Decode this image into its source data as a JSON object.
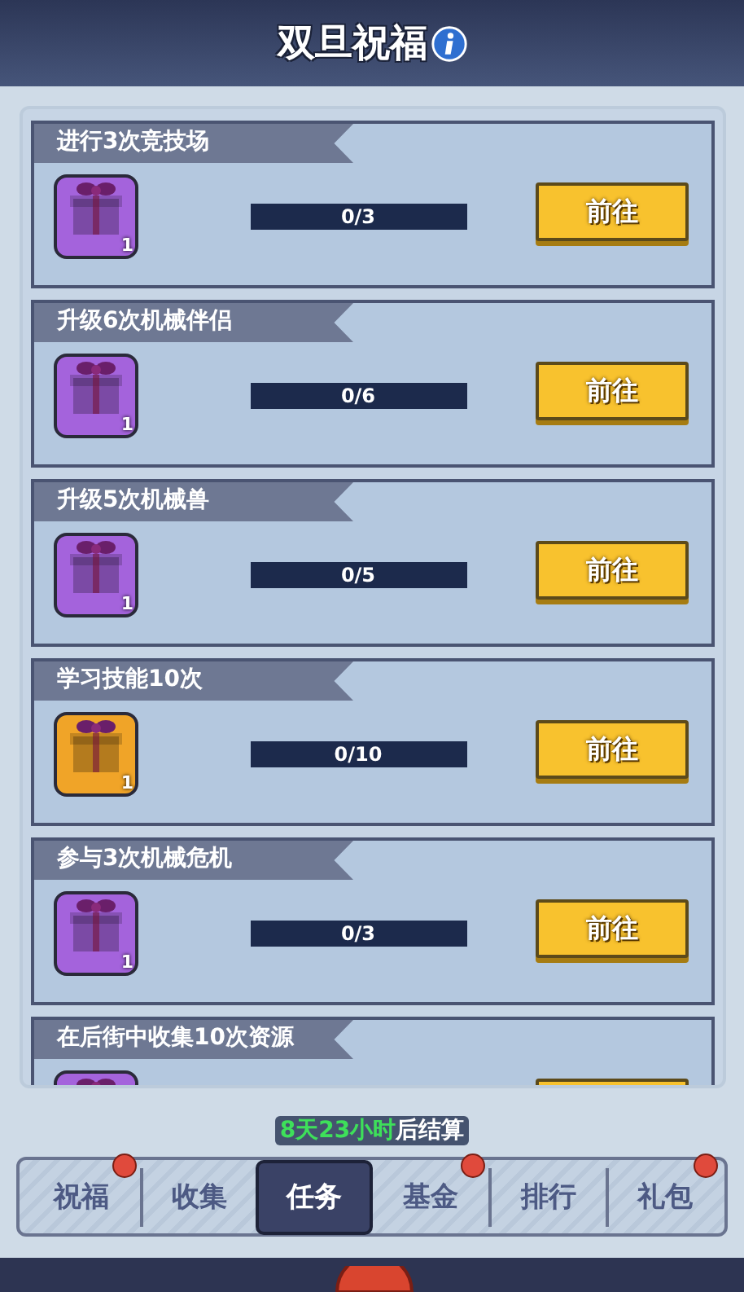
{
  "header": {
    "title": "双旦祝福"
  },
  "tasks": [
    {
      "title": "进行3次竞技场",
      "gift": {
        "color": "#a463dc",
        "count": "1"
      },
      "progress": "0/3",
      "button": "前往"
    },
    {
      "title": "升级6次机械伴侣",
      "gift": {
        "color": "#a463dc",
        "count": "1"
      },
      "progress": "0/6",
      "button": "前往"
    },
    {
      "title": "升级5次机械兽",
      "gift": {
        "color": "#a463dc",
        "count": "1"
      },
      "progress": "0/5",
      "button": "前往"
    },
    {
      "title": "学习技能10次",
      "gift": {
        "color": "#f0a428",
        "count": "1"
      },
      "progress": "0/10",
      "button": "前往"
    },
    {
      "title": "参与3次机械危机",
      "gift": {
        "color": "#a463dc",
        "count": "1"
      },
      "progress": "0/3",
      "button": "前往"
    },
    {
      "title": "在后街中收集10次资源",
      "gift": {
        "color": "#a463dc"
      }
    }
  ],
  "countdown": {
    "time": "8天23小时",
    "suffix": "后结算"
  },
  "tabs": [
    {
      "label": "祝福",
      "selected": false,
      "badge": true
    },
    {
      "label": "收集",
      "selected": false,
      "badge": false
    },
    {
      "label": "任务",
      "selected": true,
      "badge": false
    },
    {
      "label": "基金",
      "selected": false,
      "badge": true
    },
    {
      "label": "排行",
      "selected": false,
      "badge": false
    },
    {
      "label": "礼包",
      "selected": false,
      "badge": true
    }
  ]
}
